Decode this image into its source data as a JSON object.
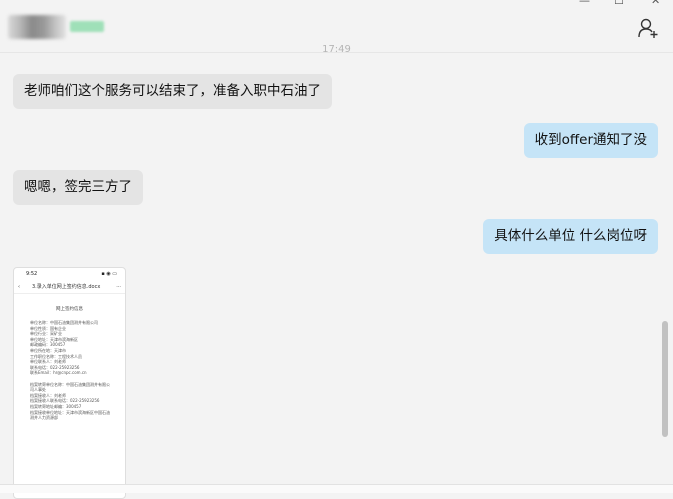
{
  "header": {
    "timestamp": "17:49"
  },
  "messages": [
    {
      "side": "left",
      "text": "老师咱们这个服务可以结束了，准备入职中石油了"
    },
    {
      "side": "right",
      "text": "收到offer通知了没"
    },
    {
      "side": "left",
      "text": "嗯嗯，签完三方了"
    },
    {
      "side": "right",
      "text": "具体什么单位 什么岗位呀"
    }
  ],
  "attachment": {
    "time": "9:52",
    "filename": "3.录入单位网上签约信息.docx",
    "heading": "网上签约信息",
    "body": "单位名称：中国石油集团测井有限公司\n单位性质：国有企业\n单位行业：采矿业\n单位地址：天津市滨海新区\n邮政编码：300457\n单位所在地：天津市\n工作职位名称：工程技术人员\n单位联系人：刘老师\n联系电话：022-25923256\n联系Email：hr@cnpc.com.cn\n\n档案转寄单位名称：中国石油集团测井有限公司人事处\n档案接收人：刘老师\n档案接收人联系电话：022-25923256\n档案转寄地址邮编：300457\n档案接收单位地址：天津市滨海新区中国石油测井人力资源部"
  },
  "colors": {
    "incoming_bubble": "#e4e4e4",
    "outgoing_bubble": "#c5e4f7",
    "background": "#f3f3f3"
  }
}
